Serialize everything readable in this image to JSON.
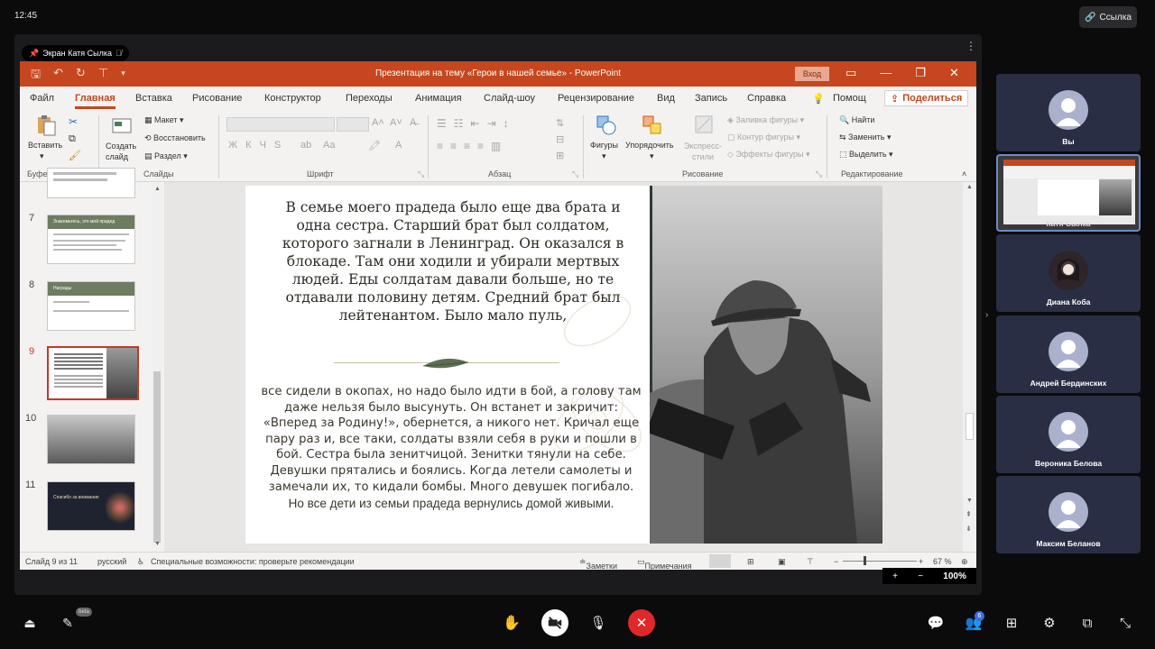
{
  "topbar": {
    "clock": "12:45",
    "link_label": "Ссылка"
  },
  "share": {
    "presenter_label": "Экран Катя Сылка"
  },
  "ppt": {
    "window_title": "Презентация на тему «Герои в нашей семье» - PowerPoint",
    "signin_label": "Вход",
    "tabs": [
      "Файл",
      "Главная",
      "Вставка",
      "Рисование",
      "Конструктор",
      "Переходы",
      "Анимация",
      "Слайд-шоу",
      "Рецензирование",
      "Вид",
      "Запись",
      "Справка",
      "Помощ"
    ],
    "active_tab": "Главная",
    "share_label": "Поделиться",
    "ribbon": {
      "paste": "Вставить",
      "new_slide": "Создать слайд",
      "layout": "Макет",
      "reset": "Восстановить",
      "section": "Раздел",
      "shapes": "Фигуры",
      "arrange": "Упорядочить",
      "quick_styles": "Экспресс-стили",
      "shape_fill": "Заливка фигуры",
      "shape_outline": "Контур фигуры",
      "shape_effects": "Эффекты фигуры",
      "find": "Найти",
      "replace": "Заменить",
      "select": "Выделить",
      "groups": {
        "clipboard": "Буфер обмена",
        "slides": "Слайды",
        "font": "Шрифт",
        "paragraph": "Абзац",
        "drawing": "Рисование",
        "editing": "Редактирование"
      }
    },
    "thumbnails": [
      {
        "num": "7",
        "title": "Знакомьтесь, это мой прадед"
      },
      {
        "num": "8",
        "title": "Награды"
      },
      {
        "num": "9",
        "title": ""
      },
      {
        "num": "10",
        "title": ""
      },
      {
        "num": "11",
        "title": "Спасибо за внимание"
      }
    ],
    "slide": {
      "text_top": "В семье моего прадеда было еще два брата и одна сестра. Старший брат был солдатом, которого загнали в Ленинград. Он оказался в блокаде. Там они ходили и убирали мертвых людей. Еды солдатам давали больше, но те отдавали половину детям. Средний брат был лейтенантом. Было мало пуль,",
      "text_bottom": "все сидели в окопах, но надо было идти в бой, а голову там даже нельзя было высунуть. Он встанет и закричит: «Вперед за Родину!», обернется, а никого нет. Кричал еще пару раз и, все таки, солдаты взяли себя в руки и пошли в бой. Сестра была зенитчицой. Зенитки тянули на себе. Девушки прятались и боялись. Когда летели самолеты и замечали их, то кидали бомбы. Много девушек погибало.",
      "text_last": "Но все дети из семьи прадеда вернулись домой живыми."
    },
    "status": {
      "slide_counter": "Слайд 9 из 11",
      "language": "русский",
      "accessibility": "Специальные возможности: проверьте рекомендации",
      "notes": "Заметки",
      "comments": "Примечания",
      "zoom": "67 %"
    }
  },
  "zoom_overlay": {
    "plus": "+",
    "minus": "−",
    "value": "100%"
  },
  "participants": [
    {
      "name": "Вы"
    },
    {
      "name": "Катя Сылка"
    },
    {
      "name": "Диана Коба"
    },
    {
      "name": "Андрей Бердинских"
    },
    {
      "name": "Вероника Белова"
    },
    {
      "name": "Максим Беланов"
    }
  ],
  "bottombar": {
    "beta_badge": "beta",
    "participants_count": "6"
  },
  "colors": {
    "ppt_accent": "#c6461f",
    "end_call": "#e0282a",
    "tile_bg": "#2a2e44"
  }
}
